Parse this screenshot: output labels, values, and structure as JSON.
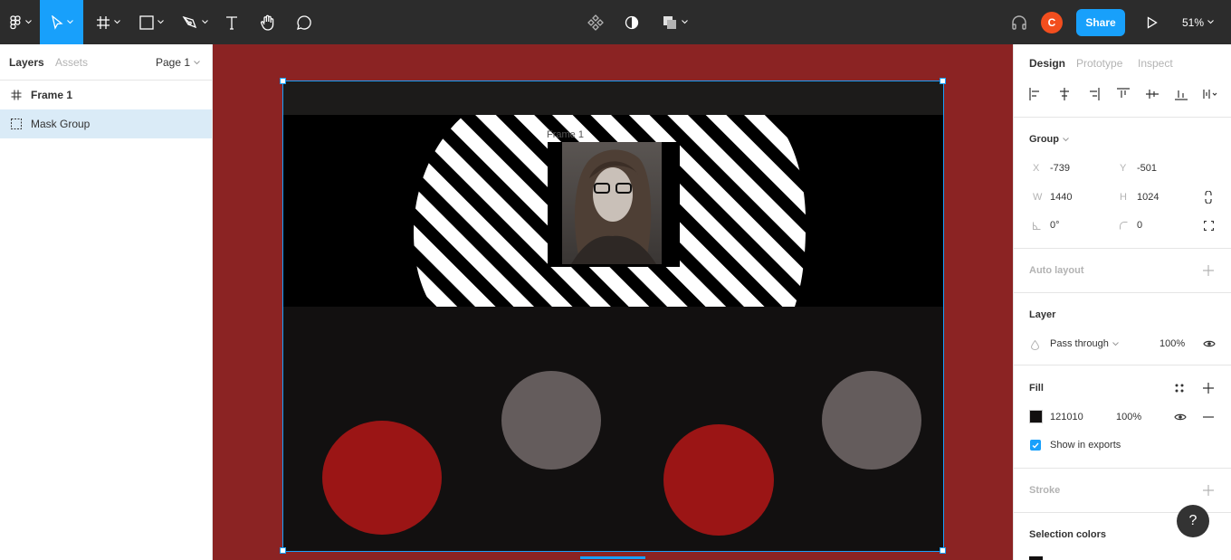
{
  "toolbar": {
    "menu_icon": "figma-logo-icon",
    "tools": [
      "move-tool",
      "frame-tool",
      "rectangle-tool",
      "pen-tool",
      "text-tool",
      "hand-tool",
      "comment-tool"
    ],
    "center_tools": [
      "components-icon",
      "contrast-icon",
      "boolean-icon"
    ],
    "avatar_initial": "C",
    "share_label": "Share",
    "zoom": "51%"
  },
  "left_panel": {
    "tabs": {
      "layers": "Layers",
      "assets": "Assets"
    },
    "page": "Page 1",
    "layers": [
      {
        "name": "Frame 1",
        "icon": "frame-icon",
        "selected": false
      },
      {
        "name": "Mask Group",
        "icon": "mask-group-icon",
        "selected": true
      }
    ]
  },
  "canvas": {
    "frame_label": "Frame 1",
    "background": "#8b2323",
    "frame_fill": "#121010"
  },
  "right_panel": {
    "tabs": {
      "design": "Design",
      "prototype": "Prototype",
      "inspect": "Inspect"
    },
    "group": {
      "title": "Group",
      "x_label": "X",
      "x": "-739",
      "y_label": "Y",
      "y": "-501",
      "w_label": "W",
      "w": "1440",
      "h_label": "H",
      "h": "1024",
      "rotation": "0°",
      "radius": "0"
    },
    "auto_layout": "Auto layout",
    "layer": {
      "title": "Layer",
      "blend": "Pass through",
      "opacity": "100%"
    },
    "fill": {
      "title": "Fill",
      "hex": "121010",
      "opacity": "100%",
      "show_in_exports": "Show in exports"
    },
    "stroke": "Stroke",
    "selection_colors": "Selection colors",
    "help": "?"
  },
  "colors": {
    "accent": "#18a0fb",
    "dark_red": "#9b1515",
    "gray_circle": "#645c5c"
  }
}
